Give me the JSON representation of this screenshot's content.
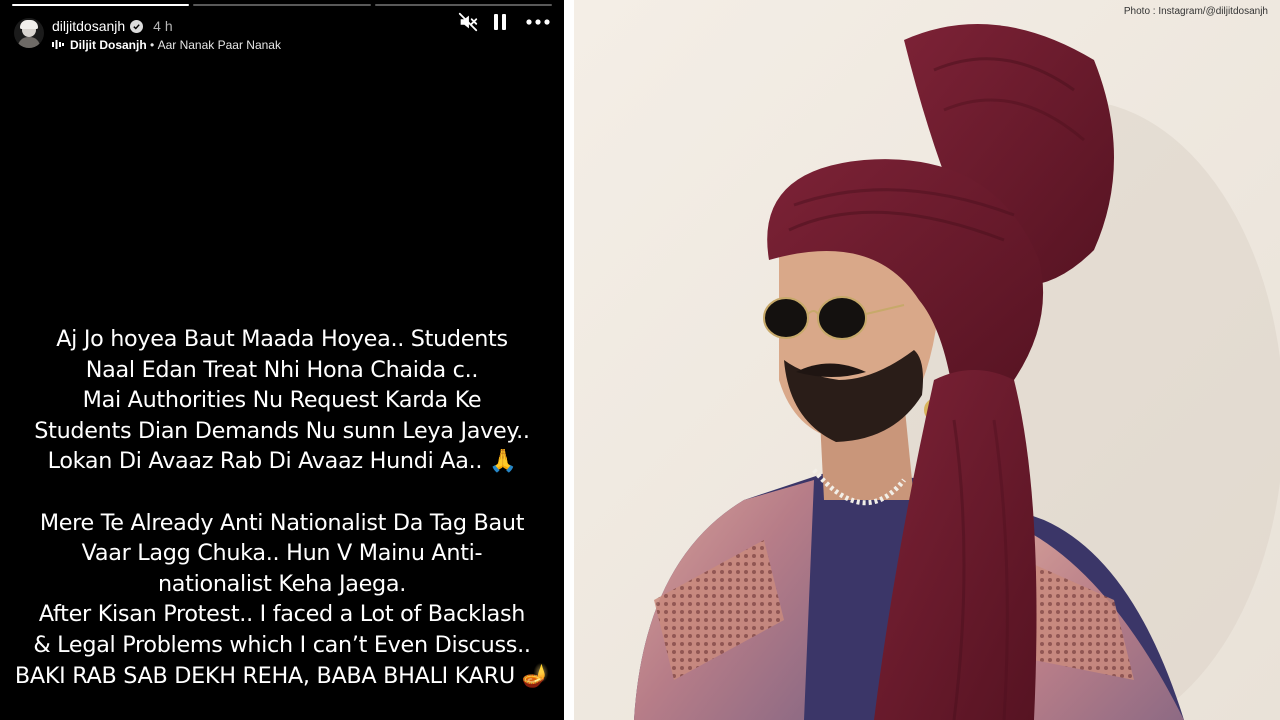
{
  "story": {
    "username": "diljitdosanjh",
    "time_ago": "4 h",
    "music": {
      "artist": "Diljit Dosanjh",
      "separator": "•",
      "song": "Aar Nanak Paar Nanak"
    },
    "progress": [
      1.0,
      0.0,
      0.0
    ],
    "controls": {
      "mute_icon": "speaker-muted-icon",
      "pause_icon": "pause-icon",
      "more_icon": "more-horizontal-icon"
    },
    "caption_lines": [
      "Aj Jo hoyea Baut Maada Hoyea.. Students",
      "Naal Edan Treat Nhi Hona Chaida c..",
      "Mai Authorities Nu Request Karda Ke",
      "Students Dian Demands Nu sunn Leya Javey..",
      "Lokan Di Avaaz Rab Di Avaaz Hundi Aa.. 🙏",
      "",
      "Mere Te Already Anti Nationalist Da Tag Baut",
      "Vaar Lagg Chuka.. Hun V Mainu Anti-",
      "nationalist Keha Jaega.",
      "After Kisan Protest.. I faced a Lot of Backlash",
      "& Legal Problems which I can’t Even Discuss..",
      "BAKI RAB SAB DEKH REHA, BABA BHALI KARU 🪔"
    ]
  },
  "photo": {
    "credit": "Photo : Instagram/@diljitdosanjh",
    "colors": {
      "background": "#efe9e0",
      "turban": "#6e1a2b",
      "jacket": "#c98a86",
      "shirt": "#3a3566"
    }
  }
}
